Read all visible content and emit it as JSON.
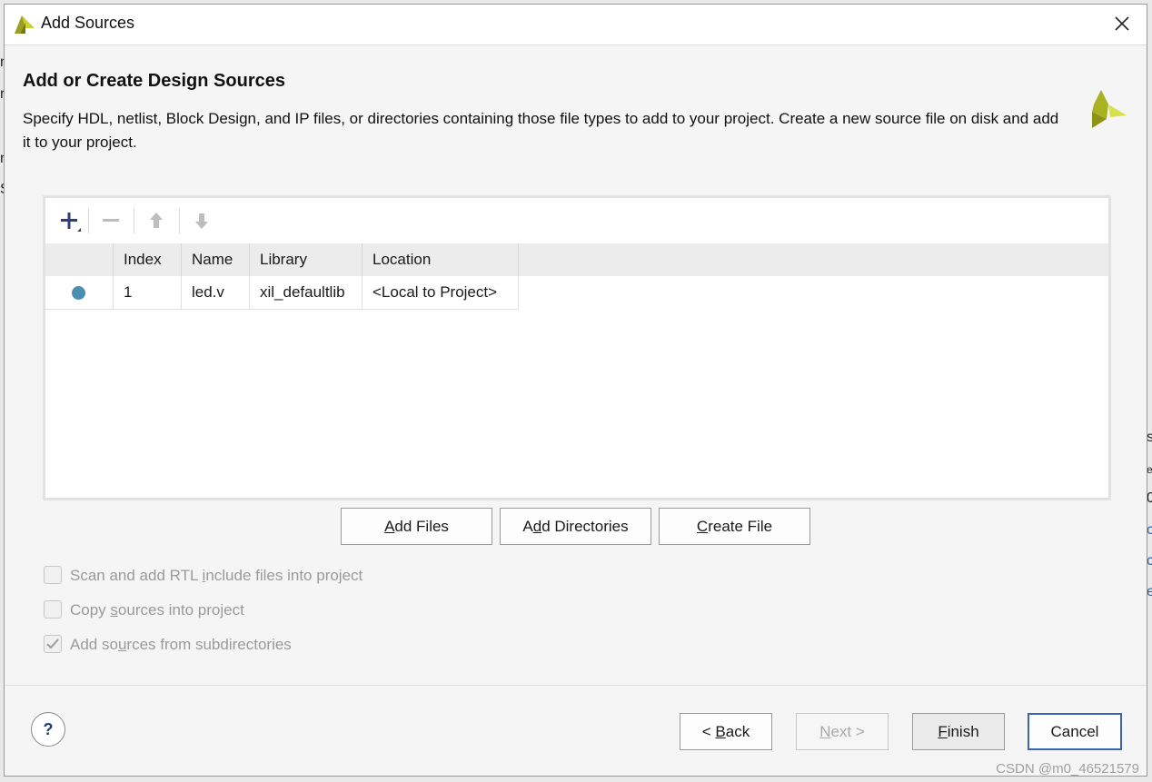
{
  "window": {
    "title": "Add Sources"
  },
  "header": {
    "title": "Add or Create Design Sources",
    "description": "Specify HDL, netlist, Block Design, and IP files, or directories containing those file types to add to your project. Create a new source file on disk and add it to your project."
  },
  "table": {
    "columns": [
      "",
      "Index",
      "Name",
      "Library",
      "Location"
    ],
    "rows": [
      {
        "status": "",
        "index": "1",
        "name": "led.v",
        "library": "xil_defaultlib",
        "location": "<Local to Project>"
      }
    ]
  },
  "actions": {
    "add_files": {
      "label": "Add Files",
      "mnemonic": "A",
      "rest": "dd Files"
    },
    "add_directories": {
      "label": "Add Directories",
      "pre": "A",
      "mnemonic": "d",
      "rest": "d Directories"
    },
    "create_file": {
      "label": "Create File",
      "mnemonic": "C",
      "rest": "reate File"
    }
  },
  "options": [
    {
      "label": "Scan and add RTL include files into project",
      "pre": "Scan and add RTL ",
      "mnemonic": "i",
      "rest": "nclude files into project",
      "checked": false
    },
    {
      "label": "Copy sources into project",
      "pre": "Copy ",
      "mnemonic": "s",
      "rest": "ources into project",
      "checked": false
    },
    {
      "label": "Add sources from subdirectories",
      "pre": "Add so",
      "mnemonic": "u",
      "rest": "rces from subdirectories",
      "checked": true
    }
  ],
  "footer": {
    "help": "?",
    "back": {
      "pre": "< ",
      "mnemonic": "B",
      "rest": "ack"
    },
    "next": {
      "mnemonic": "N",
      "rest": "ext >"
    },
    "finish": {
      "mnemonic": "F",
      "rest": "inish"
    },
    "cancel": "Cancel"
  },
  "watermark": "CSDN @m0_46521579",
  "background_fragments": [
    "s",
    "el",
    "0",
    "c",
    "c",
    "e",
    "n",
    "r",
    "m",
    "S"
  ],
  "colors": {
    "accent": "#3b64b7",
    "status_dot": "#4a8fb0",
    "logo": "#b5c22a"
  },
  "icons": {
    "app": "vivado-logo-icon",
    "close": "close-icon",
    "add": "plus-icon",
    "remove": "minus-icon",
    "move_up": "arrow-up-icon",
    "move_down": "arrow-down-icon",
    "help": "help-icon"
  }
}
